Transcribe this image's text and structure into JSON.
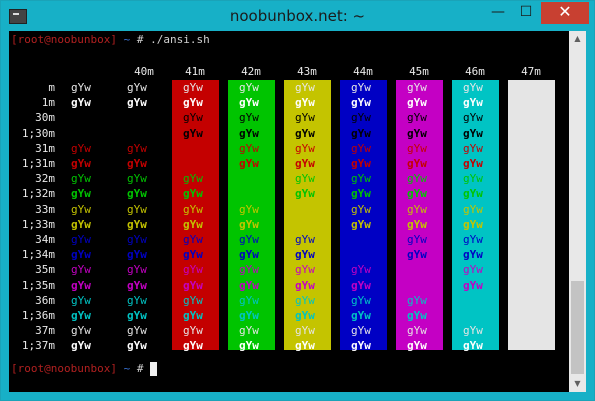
{
  "window": {
    "title": "noobunbox.net: ~",
    "min": "—",
    "max": "☐",
    "close": "✕"
  },
  "terminal": {
    "prompt_user": "[root@noobunbox",
    "prompt_tail": "]",
    "prompt_dir": " ~ ",
    "prompt_hash": "# ",
    "command": "./ansi.sh",
    "final_prompt_user": "[root@noobunbox",
    "final_prompt_tail": "]",
    "final_prompt_dir": " ~ ",
    "final_prompt_hash": "# ",
    "sample_text": "gYw",
    "bg_headers": [
      "",
      "40m",
      "41m",
      "42m",
      "43m",
      "44m",
      "45m",
      "46m",
      "47m"
    ],
    "fg_labels": [
      "m",
      "1m",
      "30m",
      "1;30m",
      "31m",
      "1;31m",
      "32m",
      "1;32m",
      "33m",
      "1;33m",
      "34m",
      "1;34m",
      "35m",
      "1;35m",
      "36m",
      "1;36m",
      "37m",
      "1;37m"
    ],
    "colors": {
      "bg": [
        "#000000",
        "#000000",
        "#c40000",
        "#00c400",
        "#c4c400",
        "#0000c4",
        "#c400c4",
        "#00c4c4",
        "#e5e5e5"
      ],
      "fg": {
        "m": "#e8e8e8",
        "1m": "#ffffff",
        "30m": "#000000",
        "1;30m": "#000000",
        "31m": "#c40000",
        "1;31m": "#c40000",
        "32m": "#00c400",
        "1;32m": "#00c400",
        "33m": "#c4c400",
        "1;33m": "#c4c400",
        "34m": "#0000c4",
        "1;34m": "#0000c4",
        "35m": "#c400c4",
        "1;35m": "#c400c4",
        "36m": "#00c4c4",
        "1;36m": "#00c4c4",
        "37m": "#e5e5e5",
        "1;37m": "#ffffff"
      }
    }
  }
}
